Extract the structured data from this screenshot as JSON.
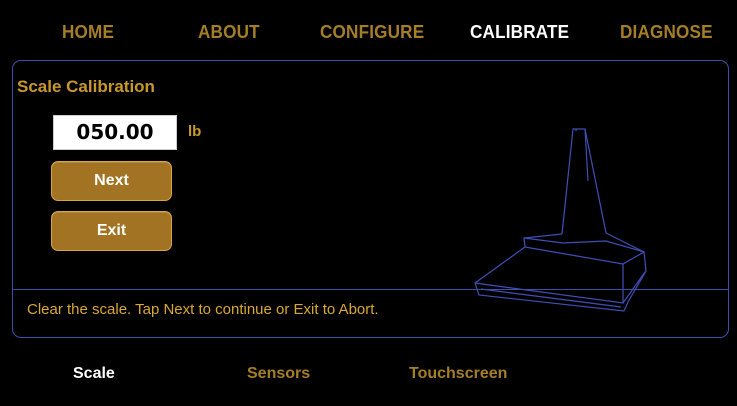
{
  "topnav": {
    "items": [
      {
        "label": "HOME",
        "active": false
      },
      {
        "label": "ABOUT",
        "active": false
      },
      {
        "label": "CONFIGURE",
        "active": false
      },
      {
        "label": "CALIBRATE",
        "active": true
      },
      {
        "label": "DIAGNOSE",
        "active": false
      }
    ]
  },
  "panel": {
    "title": "Scale Calibration",
    "weight_value": "050.00",
    "unit": "lb",
    "next_label": "Next",
    "exit_label": "Exit",
    "status": "Clear the scale. Tap Next to continue or Exit to Abort."
  },
  "bottom_tabs": [
    {
      "label": "Scale",
      "active": true
    },
    {
      "label": "Sensors",
      "active": false
    },
    {
      "label": "Touchscreen",
      "active": false
    }
  ],
  "colors": {
    "accent": "#a67e28",
    "border": "#3d4fa6",
    "button": "#a17322"
  },
  "icons": {
    "illustration": "scale-platform-icon"
  }
}
